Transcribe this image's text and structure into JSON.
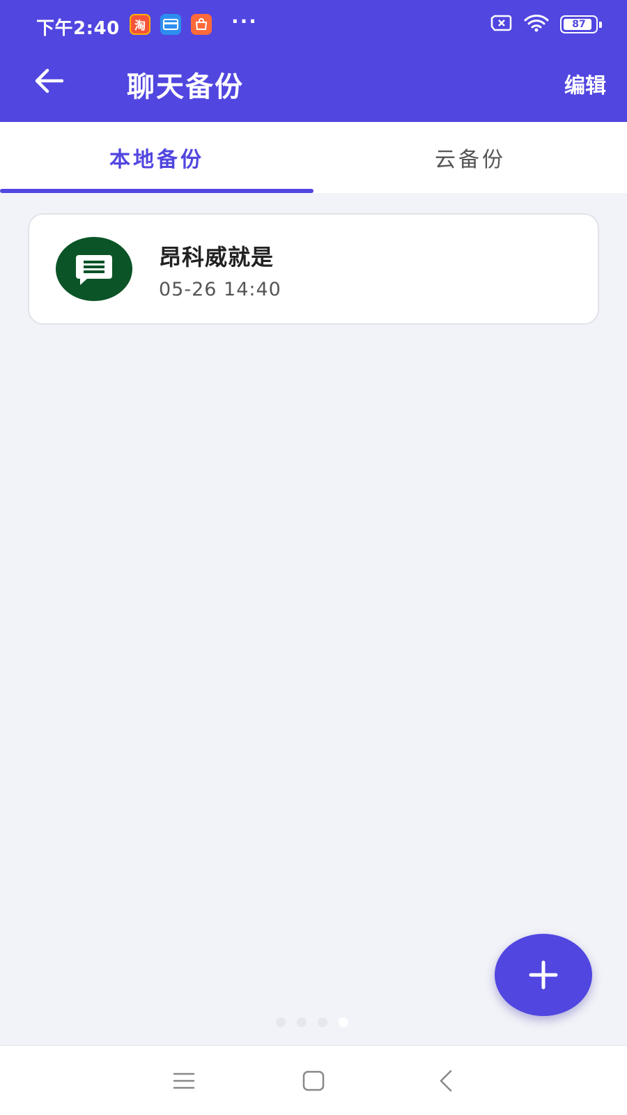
{
  "status_bar": {
    "time": "下午2:40",
    "apps": [
      "taobao-icon",
      "card-icon",
      "mi-store-icon"
    ],
    "more": "···",
    "battery": "87"
  },
  "header": {
    "title": "聊天备份",
    "edit_label": "编辑"
  },
  "tabs": [
    {
      "label": "本地备份",
      "active": true
    },
    {
      "label": "云备份",
      "active": false
    }
  ],
  "backups": [
    {
      "title": "昂科威就是",
      "date": "05-26 14:40",
      "icon": "chat-message-icon"
    }
  ],
  "pager": {
    "count": 4,
    "active_index": 3
  },
  "colors": {
    "accent": "#5146E0",
    "icon_bg": "#0B5427",
    "background": "#F2F3F8"
  }
}
